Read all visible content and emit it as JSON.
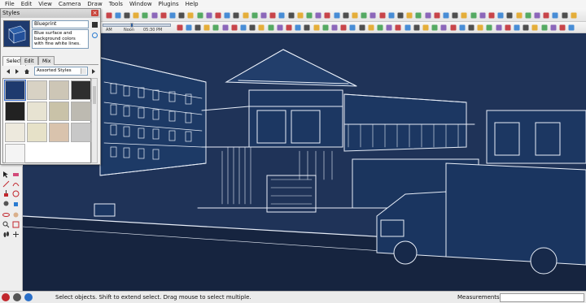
{
  "menu": [
    "File",
    "Edit",
    "View",
    "Camera",
    "Draw",
    "Tools",
    "Window",
    "Plugins",
    "Help"
  ],
  "shadow_slider": {
    "time_label_left": "AM",
    "time_label_mid": "Noon",
    "time_label_right": "05:30 PM"
  },
  "styles_dialog": {
    "title": "Styles",
    "style_name": "Blueprint",
    "style_description": "Blue surface and background colors with fine white lines.",
    "tabs": [
      "Select",
      "Edit",
      "Mix"
    ],
    "active_tab": "Select",
    "collection": "Assorted Styles"
  },
  "status": {
    "text": "Select objects. Shift to extend select. Drag mouse to select multiple.",
    "measurements_label": "Measurements",
    "measurements_value": ""
  },
  "colors": {
    "viewport_bg": "#1f3358",
    "lines": "#e8eef8",
    "ground": "#16243f"
  }
}
